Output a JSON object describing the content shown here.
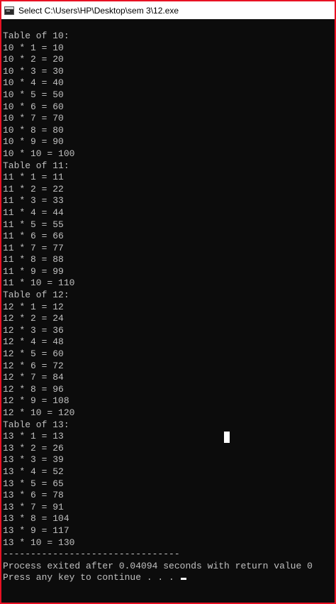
{
  "window": {
    "title": "Select C:\\Users\\HP\\Desktop\\sem 3\\12.exe"
  },
  "console": {
    "lines": [
      "Table of 10:",
      "10 * 1 = 10",
      "10 * 2 = 20",
      "10 * 3 = 30",
      "10 * 4 = 40",
      "10 * 5 = 50",
      "10 * 6 = 60",
      "10 * 7 = 70",
      "10 * 8 = 80",
      "10 * 9 = 90",
      "10 * 10 = 100",
      "Table of 11:",
      "11 * 1 = 11",
      "11 * 2 = 22",
      "11 * 3 = 33",
      "11 * 4 = 44",
      "11 * 5 = 55",
      "11 * 6 = 66",
      "11 * 7 = 77",
      "11 * 8 = 88",
      "11 * 9 = 99",
      "11 * 10 = 110",
      "Table of 12:",
      "12 * 1 = 12",
      "12 * 2 = 24",
      "12 * 3 = 36",
      "12 * 4 = 48",
      "12 * 5 = 60",
      "12 * 6 = 72",
      "12 * 7 = 84",
      "12 * 8 = 96",
      "12 * 9 = 108",
      "12 * 10 = 120",
      "Table of 13:",
      "13 * 1 = 13",
      "13 * 2 = 26",
      "13 * 3 = 39",
      "13 * 4 = 52",
      "13 * 5 = 65",
      "13 * 6 = 78",
      "13 * 7 = 91",
      "13 * 8 = 104",
      "13 * 9 = 117",
      "13 * 10 = 130"
    ],
    "separator": "--------------------------------",
    "exit_message": "Process exited after 0.04094 seconds with return value 0",
    "continue_prompt": "Press any key to continue . . . "
  },
  "colors": {
    "background": "#0c0c0c",
    "text": "#c0c0c0",
    "window_border": "#e81123"
  },
  "icons": {
    "app": "console-window-icon"
  }
}
